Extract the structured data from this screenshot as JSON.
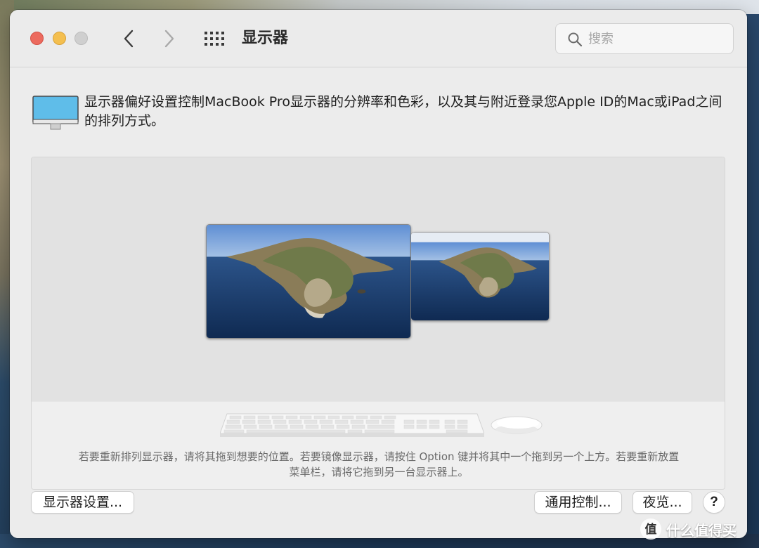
{
  "window": {
    "title": "显示器"
  },
  "search": {
    "placeholder": "搜索",
    "value": ""
  },
  "description": "显示器偏好设置控制MacBook Pro显示器的分辨率和色彩，以及其与附近登录您Apple ID的Mac或iPad之间的排列方式。",
  "arrangement": {
    "hint": "若要重新排列显示器，请将其拖到想要的位置。若要镜像显示器，请按住 Option 键并将其中一个拖到另一个上方。若要重新放置菜单栏，请将它拖到另一台显示器上。",
    "displays": [
      "main-display",
      "secondary-display"
    ]
  },
  "buttons": {
    "display_settings": "显示器设置...",
    "universal_control": "通用控制...",
    "night_shift": "夜览...",
    "help": "?"
  },
  "watermark": {
    "text": "什么值得买",
    "logo_glyph": "值"
  },
  "colors": {
    "close": "#ec6a5e",
    "minimize": "#f4bf4f",
    "zoom_disabled": "#cfcfcf",
    "display_icon": "#5bb8e8"
  }
}
